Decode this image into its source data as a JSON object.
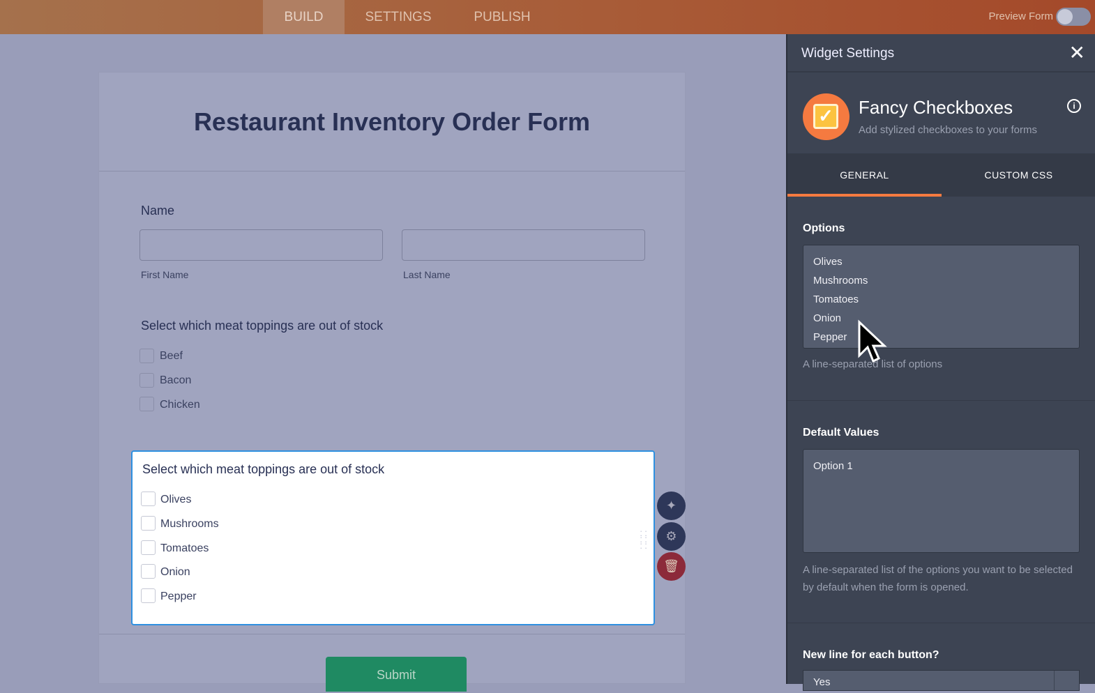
{
  "topbar": {
    "tabs": [
      "BUILD",
      "SETTINGS",
      "PUBLISH"
    ],
    "preview_label": "Preview Form"
  },
  "form": {
    "title": "Restaurant Inventory Order Form",
    "name_label": "Name",
    "first_name": "First Name",
    "last_name": "Last Name",
    "q1": {
      "label": "Select which meat toppings are out of stock",
      "options": [
        "Beef",
        "Bacon",
        "Chicken"
      ]
    },
    "q2": {
      "label": "Select which meat toppings are out of stock",
      "options": [
        "Olives",
        "Mushrooms",
        "Tomatoes",
        "Onion",
        "Pepper"
      ]
    },
    "submit": "Submit"
  },
  "panel": {
    "title": "Widget Settings",
    "widget_name": "Fancy Checkboxes",
    "widget_desc": "Add stylized checkboxes to your forms",
    "tabs": [
      "GENERAL",
      "CUSTOM CSS"
    ],
    "options_label": "Options",
    "options": [
      "Olives",
      "Mushrooms",
      "Tomatoes",
      "Onion",
      "Pepper"
    ],
    "options_hint": "A line-separated list of options",
    "defaults_label": "Default Values",
    "defaults_value": "Option 1",
    "defaults_hint": "A line-separated list of the options you want to be selected by default when the form is opened.",
    "newline_label": "New line for each button?",
    "newline_value": "Yes"
  }
}
